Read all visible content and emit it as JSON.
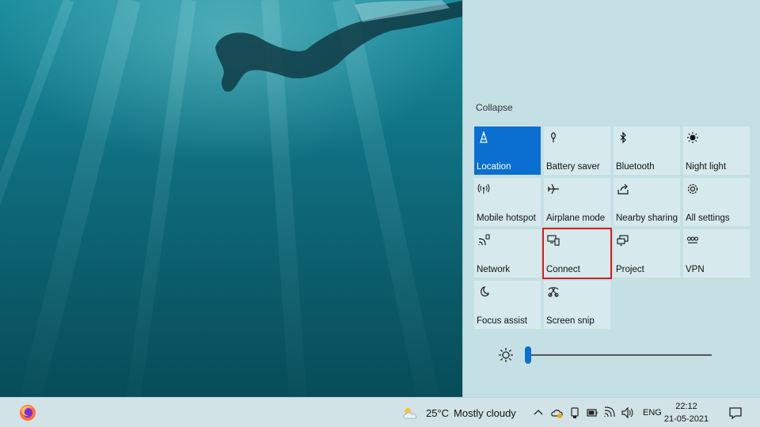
{
  "action_center": {
    "collapse_label": "Collapse",
    "tiles": [
      {
        "label": "Location",
        "icon": "location-icon",
        "active": true
      },
      {
        "label": "Battery saver",
        "icon": "battery-saver-icon"
      },
      {
        "label": "Bluetooth",
        "icon": "bluetooth-icon"
      },
      {
        "label": "Night light",
        "icon": "night-light-icon"
      },
      {
        "label": "Mobile hotspot",
        "icon": "mobile-hotspot-icon"
      },
      {
        "label": "Airplane mode",
        "icon": "airplane-icon"
      },
      {
        "label": "Nearby sharing",
        "icon": "nearby-sharing-icon"
      },
      {
        "label": "All settings",
        "icon": "gear-icon"
      },
      {
        "label": "Network",
        "icon": "network-icon"
      },
      {
        "label": "Connect",
        "icon": "connect-icon",
        "highlighted": true
      },
      {
        "label": "Project",
        "icon": "project-icon"
      },
      {
        "label": "VPN",
        "icon": "vpn-icon"
      },
      {
        "label": "Focus assist",
        "icon": "moon-icon"
      },
      {
        "label": "Screen snip",
        "icon": "screen-snip-icon"
      }
    ],
    "brightness": {
      "icon": "brightness-icon",
      "level": 0
    }
  },
  "taskbar": {
    "pinned": [
      {
        "name": "Firefox",
        "icon": "firefox-icon"
      }
    ],
    "weather": {
      "temperature": "25°C",
      "condition": "Mostly cloudy",
      "icon": "partly-cloudy-icon"
    },
    "tray_icons": [
      "chevron-up-icon",
      "onedrive-sync-icon",
      "usb-device-icon",
      "battery-icon",
      "wifi-icon",
      "speaker-icon"
    ],
    "language": "ENG",
    "time": "22:12",
    "date": "21-05-2021",
    "notification_icon": "notification-icon"
  },
  "colors": {
    "accent": "#0a6fd0",
    "highlight_box": "#e01818",
    "tile_bg": "#d6eaed",
    "panel_bg": "#c5e0e4"
  }
}
